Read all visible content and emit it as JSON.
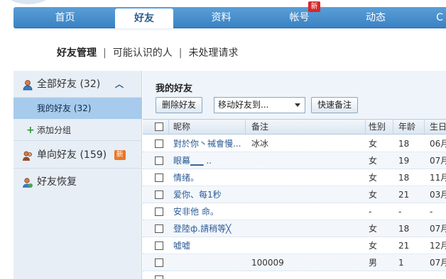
{
  "nav": {
    "items": [
      "首页",
      "好友",
      "资料",
      "帐号",
      "动态",
      "C"
    ],
    "new_badge": "新"
  },
  "subtabs": [
    "好友管理",
    "可能认识的人",
    "未处理请求"
  ],
  "separator": "|",
  "sidebar": {
    "all_friends": "全部好友 (32)",
    "my_friends": "我的好友 (32)",
    "add_group": "添加分组",
    "one_way": "单向好友 (159)",
    "new_tag": "新",
    "recover": "好友恢复"
  },
  "main": {
    "title": "我的好友",
    "delete_button": "删除好友",
    "move_select": "移动好友到...",
    "quick_note_button": "快速备注",
    "headers": {
      "nickname": "昵称",
      "note": "备注",
      "gender": "性别",
      "age": "年龄",
      "birthday": "生日"
    }
  },
  "rows": [
    {
      "nickname": "對於你丶祴會慢...",
      "note": "冰冰",
      "gender": "女",
      "age": "18",
      "birthday": "06月"
    },
    {
      "nickname": "      眼幕▁▁       ..",
      "note": "",
      "gender": "女",
      "age": "19",
      "birthday": "07月"
    },
    {
      "nickname": "  情绪。",
      "note": "",
      "gender": "女",
      "age": "18",
      "birthday": "11月"
    },
    {
      "nickname": "爱你、每1秒",
      "note": "",
      "gender": "女",
      "age": "21",
      "birthday": "03月"
    },
    {
      "nickname": "          安非他 命。",
      "note": "",
      "gender": "-",
      "age": "-",
      "birthday": "-"
    },
    {
      "nickname": "登陸ф.請稍等╳",
      "note": "",
      "gender": "女",
      "age": "18",
      "birthday": "07月"
    },
    {
      "nickname": "  嘘嘘",
      "note": "",
      "gender": "女",
      "age": "21",
      "birthday": "12月"
    },
    {
      "nickname": "",
      "note": "100009",
      "gender": "男",
      "age": "1",
      "birthday": "07月"
    },
    {
      "nickname": "",
      "note": "",
      "gender": "",
      "age": "",
      "birthday": ""
    }
  ],
  "colors": {
    "nav": "#3a82c4",
    "sidebar": "#e7eef6",
    "selected": "#a7cbec",
    "link": "#2a5a94"
  }
}
